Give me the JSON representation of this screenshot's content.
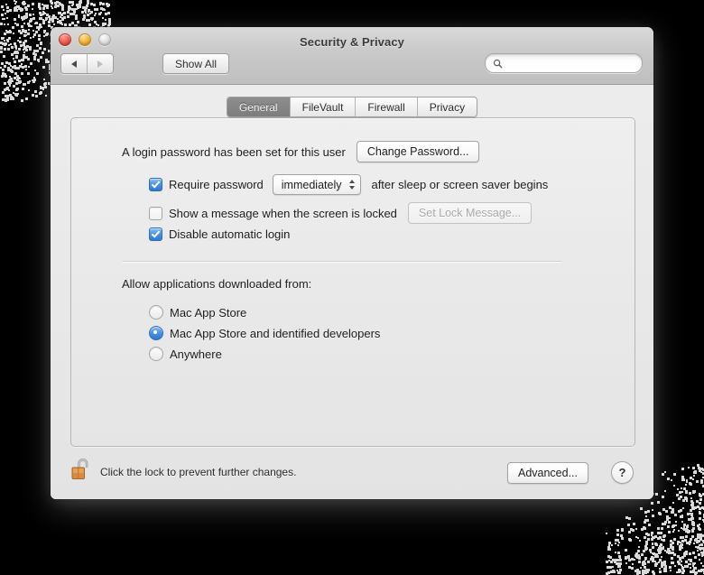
{
  "window": {
    "title": "Security & Privacy",
    "traffic_lights": [
      "close-button",
      "minimize-button",
      "zoom-button"
    ]
  },
  "toolbar": {
    "back_label": "back-arrow-icon",
    "forward_label": "forward-arrow-icon",
    "show_all_label": "Show All",
    "search": {
      "placeholder": "",
      "value": "",
      "icon": "search-icon"
    }
  },
  "tabs": [
    {
      "label": "General",
      "active": true
    },
    {
      "label": "FileVault",
      "active": false
    },
    {
      "label": "Firewall",
      "active": false
    },
    {
      "label": "Privacy",
      "active": false
    }
  ],
  "general": {
    "password_status": "A login password has been set for this user",
    "change_password_button": "Change Password...",
    "require_password": {
      "checked": true,
      "label": "Require password",
      "popup_value": "immediately",
      "suffix": "after sleep or screen saver begins"
    },
    "lock_message": {
      "checked": false,
      "label": "Show a message when the screen is locked",
      "button": "Set Lock Message...",
      "button_disabled": true
    },
    "disable_auto_login": {
      "checked": true,
      "label": "Disable automatic login"
    },
    "allow_apps": {
      "heading": "Allow applications downloaded from:",
      "options": [
        {
          "label": "Mac App Store",
          "selected": false
        },
        {
          "label": "Mac App Store and identified developers",
          "selected": true
        },
        {
          "label": "Anywhere",
          "selected": false
        }
      ]
    }
  },
  "footer": {
    "lock_icon": "unlocked-padlock-icon",
    "lock_text": "Click the lock to prevent further changes.",
    "advanced_button": "Advanced...",
    "help_button": "?"
  },
  "colors": {
    "accent_blue": "#2d78d2",
    "lock_orange": "#d98c3e",
    "window_chrome": "#ececec",
    "active_tab": "#7d7d7d"
  }
}
